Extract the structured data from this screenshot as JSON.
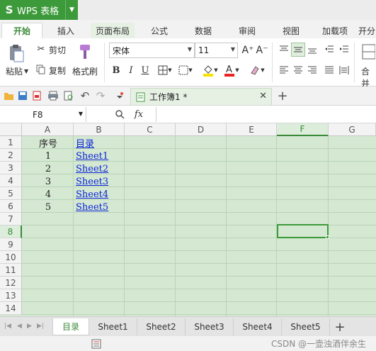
{
  "app": {
    "name": "WPS 表格",
    "logo": "S"
  },
  "tabs": [
    "开始",
    "插入",
    "页面布局",
    "公式",
    "数据",
    "审阅",
    "视图",
    "加载项",
    "开分"
  ],
  "ribbon": {
    "paste": "粘贴",
    "cut": "剪切",
    "copy": "复制",
    "format_painter": "格式刷",
    "font_name": "宋体",
    "font_size": "11",
    "bold": "B",
    "italic": "I",
    "underline": "U",
    "grow_font": "A⁺",
    "shrink_font": "A⁻",
    "merge": "合并"
  },
  "qat": {
    "doc_title": "工作簿1 *"
  },
  "formula_bar": {
    "cell_ref": "F8",
    "fx": "fx",
    "formula": ""
  },
  "grid": {
    "columns": [
      "A",
      "B",
      "C",
      "D",
      "E",
      "F",
      "G"
    ],
    "selected_column": "F",
    "rows": [
      "1",
      "2",
      "3",
      "4",
      "5",
      "6",
      "7",
      "8",
      "9",
      "10",
      "11",
      "12",
      "13",
      "14"
    ],
    "selected_row": "8",
    "cells": {
      "A1": "序号",
      "B1": "目录",
      "A2": "1",
      "B2": "Sheet1",
      "A3": "2",
      "B3": "Sheet2",
      "A4": "3",
      "B4": "Sheet3",
      "A5": "4",
      "B5": "Sheet4",
      "A6": "5",
      "B6": "Sheet5"
    }
  },
  "sheet_tabs": [
    "目录",
    "Sheet1",
    "Sheet2",
    "Sheet3",
    "Sheet4",
    "Sheet5"
  ],
  "active_sheet": "目录",
  "watermark": "CSDN @一壶浊酒伴余生",
  "colors": {
    "brand": "#3d9a3b",
    "sheet_bg": "#d4e8d2",
    "link": "#0b24d8"
  }
}
